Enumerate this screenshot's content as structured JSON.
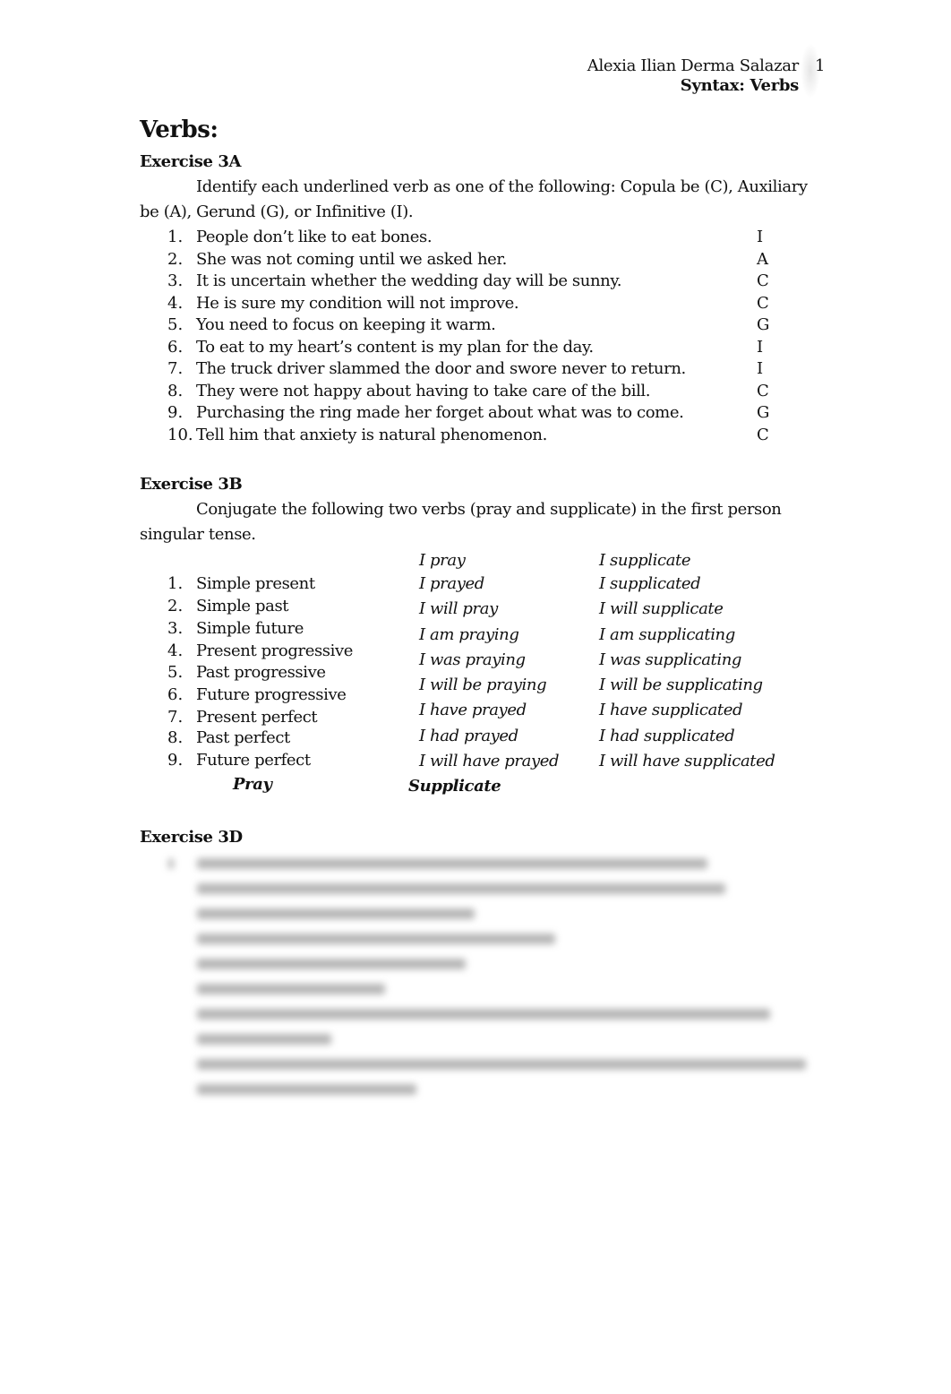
{
  "header": {
    "author": "Alexia Ilian Derma Salazar",
    "page_number": "1",
    "running_title": "Syntax: Verbs"
  },
  "title": "Verbs:",
  "exercise_3a": {
    "heading": "Exercise 3A",
    "instructions_line1": "Identify each underlined verb as one of the following: Copula be (C), Auxiliary",
    "instructions_line2": "be (A), Gerund (G), or Infinitive (I).",
    "items": [
      {
        "num": "1.",
        "sentence": "People don’t like to eat bones.",
        "answer": "I"
      },
      {
        "num": "2.",
        "sentence": "She was not coming until we asked her.",
        "answer": "A"
      },
      {
        "num": "3.",
        "sentence": "It is uncertain whether the wedding day will be sunny.",
        "answer": "C"
      },
      {
        "num": "4.",
        "sentence": "He is sure my condition will not improve.",
        "answer": "C"
      },
      {
        "num": "5.",
        "sentence": "You need to focus on keeping it warm.",
        "answer": "G"
      },
      {
        "num": "6.",
        "sentence": "To eat to my heart’s content is my plan for the day.",
        "answer": "I"
      },
      {
        "num": "7.",
        "sentence": "The truck driver slammed the door and swore never to return.",
        "answer": "I"
      },
      {
        "num": "8.",
        "sentence": "They were not happy about having to take care of the bill.",
        "answer": "C"
      },
      {
        "num": "9.",
        "sentence": "Purchasing the ring made her forget about what was to come.",
        "answer": "G"
      },
      {
        "num": "10.",
        "sentence": "Tell him that anxiety is natural phenomenon.",
        "answer": "C"
      }
    ]
  },
  "exercise_3b": {
    "heading": "Exercise 3B",
    "instructions_line1": "Conjugate the following two verbs (pray and supplicate) in the first person",
    "instructions_line2": "singular tense.",
    "tenses": [
      {
        "num": "1.",
        "label": "Simple present"
      },
      {
        "num": "2.",
        "label": "Simple past"
      },
      {
        "num": "3.",
        "label": "Simple future"
      },
      {
        "num": "4.",
        "label": "Present progressive"
      },
      {
        "num": "5.",
        "label": "Past progressive"
      },
      {
        "num": "6.",
        "label": "Future progressive"
      },
      {
        "num": "7.",
        "label": "Present perfect"
      },
      {
        "num": "8.",
        "label": "Past perfect"
      },
      {
        "num": "9.",
        "label": "Future perfect"
      }
    ],
    "pray_forms": [
      "I pray",
      "I prayed",
      "I will pray",
      "I am praying",
      "I was praying",
      "I will be praying",
      "I have prayed",
      "I had prayed",
      "I will have prayed"
    ],
    "supplicate_forms": [
      "I supplicate",
      "I supplicated",
      "I will supplicate",
      "I am supplicating",
      "I was supplicating",
      "I will be supplicating",
      "I have supplicated",
      "I had supplicated",
      "I will have supplicated"
    ],
    "column_label_pray": "Pray",
    "column_label_supplicate": "Supplicate"
  },
  "exercise_3d": {
    "heading": "Exercise 3D",
    "body_obscured": true
  }
}
